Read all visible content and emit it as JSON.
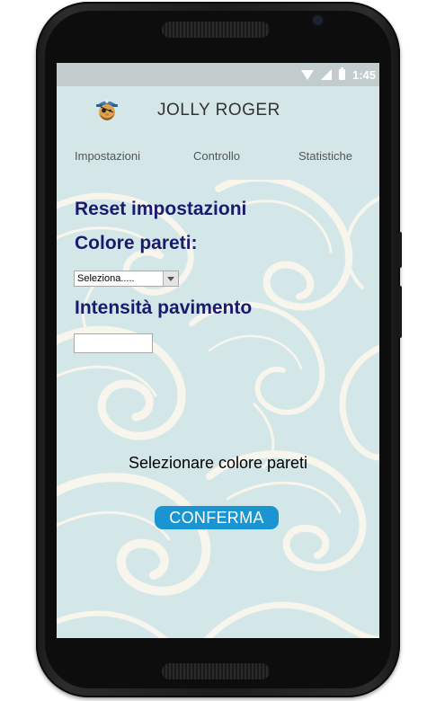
{
  "status_bar": {
    "time": "1:45",
    "icons": [
      "wifi-icon",
      "signal-icon",
      "battery-icon"
    ],
    "text_color": "#ffffff",
    "background": "#c2cccc"
  },
  "app_bar": {
    "icon": "pirate-icon",
    "title": "JOLLY ROGER",
    "background": "#d4e6e7"
  },
  "tabs": [
    {
      "label": "Impostazioni"
    },
    {
      "label": "Controllo"
    },
    {
      "label": "Statistiche"
    }
  ],
  "form": {
    "reset_heading": "Reset impostazioni",
    "wall_color_heading": "Colore pareti:",
    "wall_color_select": {
      "selected": "Seleziona....."
    },
    "floor_intensity_heading": "Intensità pavimento",
    "floor_intensity_input": {
      "value": ""
    },
    "heading_color": "#1a1a6e"
  },
  "message": "Selezionare colore pareti",
  "confirm_button": {
    "label": "CONFERMA",
    "color": "#1a95d2"
  }
}
